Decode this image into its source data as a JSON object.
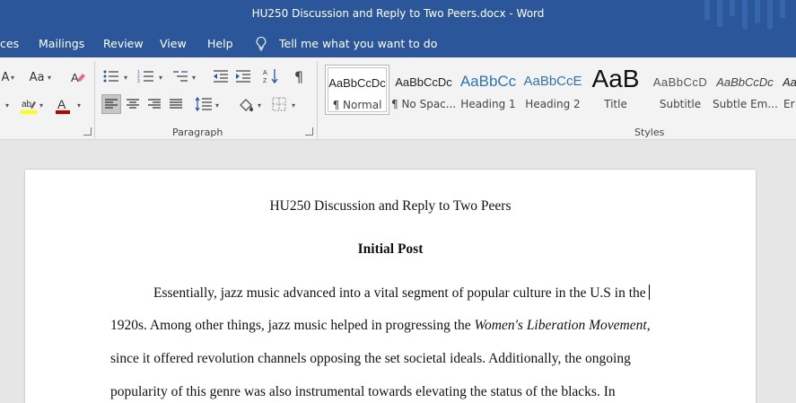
{
  "window": {
    "title": "HU250 Discussion and Reply to Two Peers.docx  -  Word"
  },
  "menu": {
    "tabs": [
      "ces",
      "Mailings",
      "Review",
      "View",
      "Help"
    ],
    "tell_me": "Tell me what you want to do"
  },
  "ribbon": {
    "font_size_label": "Aa",
    "paragraph_mark": "¶",
    "groups": {
      "paragraph": "Paragraph",
      "styles": "Styles"
    },
    "styles": [
      {
        "sample": "AaBbCcDc",
        "name": "¶ Normal",
        "selected": true
      },
      {
        "sample": "AaBbCcDc",
        "name": "¶ No Spac..."
      },
      {
        "sample": "AaBbCc",
        "name": "Heading 1"
      },
      {
        "sample": "AaBbCcE",
        "name": "Heading 2"
      },
      {
        "sample": "AaB",
        "name": "Title"
      },
      {
        "sample": "AaBbCcD",
        "name": "Subtitle"
      },
      {
        "sample": "AaBbCcDc",
        "name": "Subtle Em..."
      },
      {
        "sample": "Aa",
        "name": "Er"
      }
    ],
    "colors": {
      "highlight": "#ffff00",
      "font_color": "#c00000",
      "accent": "#2b579a"
    }
  },
  "document": {
    "title": "HU250 Discussion and Reply to Two Peers",
    "heading": "Initial Post",
    "lines": [
      "Essentially, jazz music advanced into a vital segment of popular culture in the U.S in the",
      "1920s. Among other things, jazz music helped in progressing the ",
      "since it offered revolution channels opposing the set societal ideals. Additionally, the ongoing",
      "popularity of this genre was also instrumental towards elevating the status of the blacks. In"
    ],
    "italic_phrase": "Women's Liberation Movement",
    "italic_suffix": ","
  }
}
